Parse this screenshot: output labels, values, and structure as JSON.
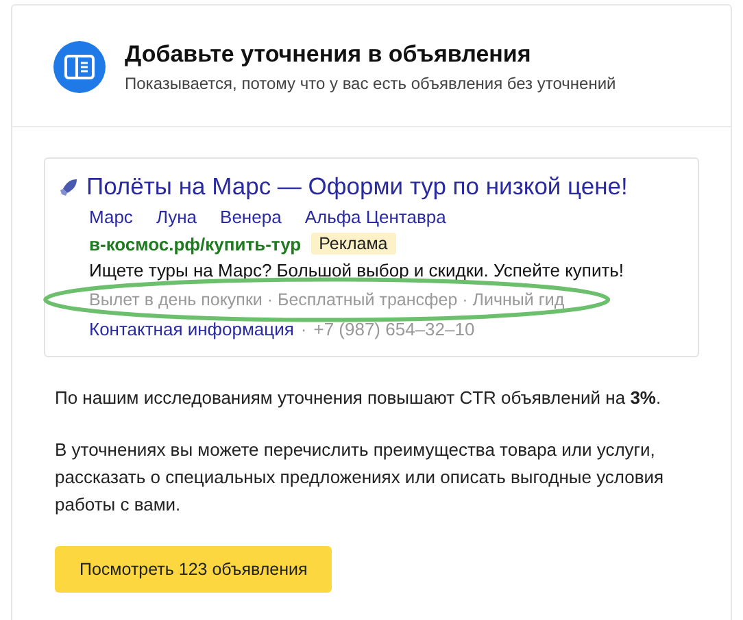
{
  "header": {
    "title": "Добавьте уточнения в объявления",
    "subtitle": "Показывается, потому что у вас есть объявления без уточнений"
  },
  "ad": {
    "title": "Полёты на Марс — Оформи тур по низкой цене!",
    "sitelinks": [
      "Марс",
      "Луна",
      "Венера",
      "Альфа Центавра"
    ],
    "url": "в-космос.рф/купить-тур",
    "label": "Реклама",
    "text": "Ищете туры на Марс? Большой выбор и скидки. Успейте купить!",
    "callouts": "Вылет в день покупки · Бесплатный трансфер · Личный гид",
    "contact": {
      "link": "Контактная информация",
      "separator": "·",
      "phone": "+7 (987) 654–32–10"
    }
  },
  "paragraphs": [
    "По нашим исследованиям уточнения повышают CTR объявлений на **3%**.",
    "В уточнениях вы можете перечислить преимущества товара или услуги, рассказать о специальных предложениях или описать выгодные условия работы с вами."
  ],
  "button": "Посмотреть 123 объявления"
}
